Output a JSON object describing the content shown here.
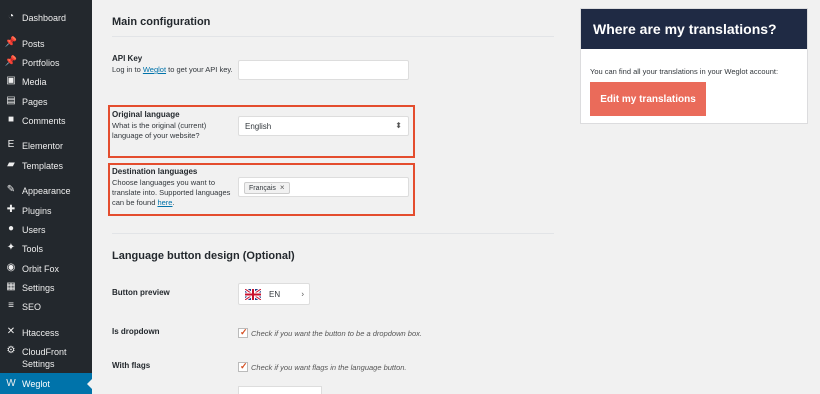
{
  "sidebar": {
    "items": [
      {
        "label": "Dashboard",
        "icon": "dashboard-icon",
        "glyph": "◔"
      },
      {
        "label": "Posts",
        "icon": "pushpin-icon",
        "glyph": "📌"
      },
      {
        "label": "Portfolios",
        "icon": "pushpin-icon",
        "glyph": "📌"
      },
      {
        "label": "Media",
        "icon": "media-icon",
        "glyph": "▣"
      },
      {
        "label": "Pages",
        "icon": "pages-icon",
        "glyph": "▤"
      },
      {
        "label": "Comments",
        "icon": "comment-icon",
        "glyph": "■"
      },
      {
        "label": "Elementor",
        "icon": "elementor-icon",
        "glyph": "E"
      },
      {
        "label": "Templates",
        "icon": "folder-icon",
        "glyph": "▰"
      },
      {
        "label": "Appearance",
        "icon": "paintbrush-icon",
        "glyph": "✎"
      },
      {
        "label": "Plugins",
        "icon": "plugin-icon",
        "glyph": "✚"
      },
      {
        "label": "Users",
        "icon": "user-icon",
        "glyph": "●"
      },
      {
        "label": "Tools",
        "icon": "wrench-icon",
        "glyph": "✦"
      },
      {
        "label": "Orbit Fox",
        "icon": "fox-icon",
        "glyph": "◉"
      },
      {
        "label": "Settings",
        "icon": "settings-icon",
        "glyph": "▦"
      },
      {
        "label": "SEO",
        "icon": "seo-icon",
        "glyph": "≡"
      },
      {
        "label": "Htaccess",
        "icon": "htaccess-icon",
        "glyph": "✕"
      },
      {
        "label": "CloudFront\nSettings",
        "icon": "gear-icon",
        "glyph": "⚙"
      },
      {
        "label": "Weglot",
        "icon": "weglot-icon",
        "glyph": "W"
      }
    ]
  },
  "main": {
    "section_title": "Main configuration",
    "api_key": {
      "label": "API Key",
      "desc_prefix": "Log in to ",
      "link_text": "Weglot",
      "desc_suffix": " to get your API key.",
      "value": ""
    },
    "original_language": {
      "label": "Original language",
      "desc": "What is the original (current) language of your website?",
      "value": "English"
    },
    "destination_languages": {
      "label": "Destination languages",
      "desc_prefix": "Choose languages you want to translate into. Supported languages can be found ",
      "link_text": "here",
      "desc_suffix": ".",
      "tag": "Français",
      "tag_remove": "×"
    },
    "language_button_title": "Language button design (Optional)",
    "button_preview": {
      "label": "Button preview",
      "value": "EN",
      "chevron": "›"
    },
    "is_dropdown": {
      "label": "Is dropdown",
      "text": "Check if you want the button to be a dropdown box."
    },
    "with_flags": {
      "label": "With flags",
      "text": "Check if you want flags in the language button."
    }
  },
  "card": {
    "title": "Where are my translations?",
    "text": "You can find all your translations in your Weglot account:",
    "button": "Edit my translations"
  },
  "colors": {
    "sidebar_bg": "#23282d",
    "active_bg": "#0073aa",
    "highlight": "#e44d2e",
    "card_header": "#1f2a44",
    "card_button": "#ea6b5a"
  }
}
